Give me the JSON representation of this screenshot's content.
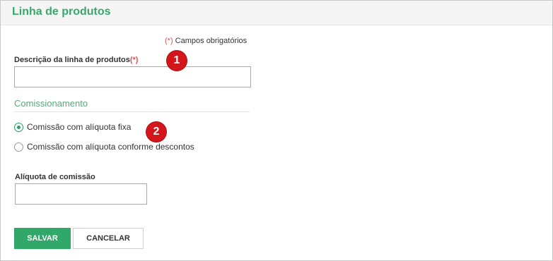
{
  "header": {
    "title": "Linha de produtos"
  },
  "form": {
    "required_marker": "(*)",
    "required_note": "Campos obrigatórios",
    "description_label": "Descrição da linha de produtos",
    "description_value": "",
    "commission_section": "Comissionamento",
    "radio_options": [
      {
        "label": "Comissão com alíquota fixa",
        "checked": true
      },
      {
        "label": "Comissão com alíquota conforme descontos",
        "checked": false
      }
    ],
    "rate_label": "Alíquota de comissão",
    "rate_value": ""
  },
  "buttons": {
    "save": "SALVAR",
    "cancel": "CANCELAR"
  },
  "annotations": [
    "1",
    "2"
  ],
  "colors": {
    "accent": "#2fa86a",
    "title": "#3aa76d",
    "required": "#d9534f",
    "badge": "#d2161b"
  }
}
